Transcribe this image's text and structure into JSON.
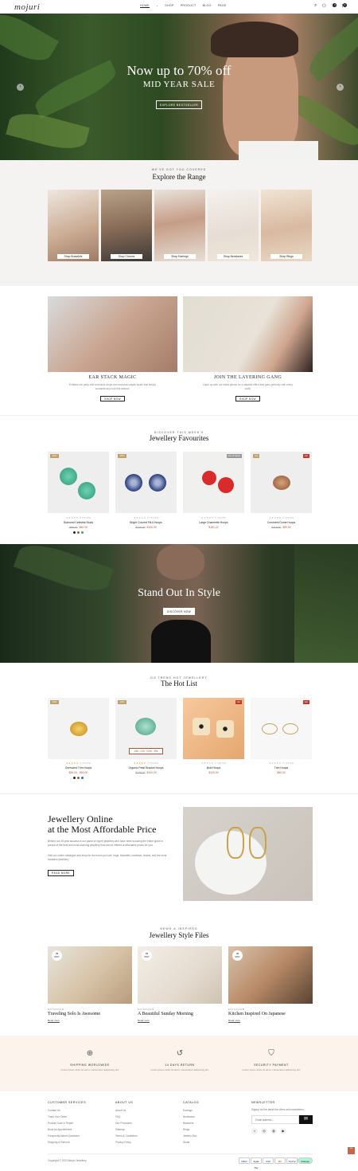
{
  "header": {
    "logo": "mojuri",
    "nav": [
      "HOME",
      "SHOP",
      "PRODUCT",
      "BLOG",
      "PAGE"
    ],
    "cart_count": "0",
    "wish_count": "0"
  },
  "hero": {
    "title": "Now up to 70% off",
    "subtitle": "MID YEAR SALE",
    "button": "EXPLORE BESTSELLER"
  },
  "range": {
    "kicker": "WE'VE GOT YOU COVERED",
    "title": "Explore the Range",
    "items": [
      "Shop Bracelets",
      "Shop Charms",
      "Shop Earrings",
      "Shop Necklaces",
      "Shop Rings"
    ]
  },
  "promos": [
    {
      "title": "EAR STACK MAGIC",
      "desc": "Endless ear party with exclusive drops and reworked staple styles that simply complete any look this season.",
      "button": "SHOP NOW"
    },
    {
      "title": "JOIN THE LAYERING GANG",
      "desc": "Layer up with our latest pieces for a stacked effect that pairs perfectly with every outfit.",
      "button": "SHOP NOW"
    }
  ],
  "favourites": {
    "kicker": "DISCOVER THIS WEEK'S",
    "title": "Jewellery Favourites",
    "products": [
      {
        "tag": "-20%",
        "name": "Diamond Celestial Studs",
        "old": "$96.00",
        "price": "$60.00",
        "reviews": "0 review"
      },
      {
        "tag": "-20%",
        "name": "Bright Colored Fill-it Hoops",
        "old": "$120.00",
        "price": "$100.00",
        "reviews": "0 review"
      },
      {
        "tag": "Out of Stock",
        "name": "Large Charmette Hoops",
        "old": "",
        "price": "$151.22",
        "reviews": "0 review"
      },
      {
        "tag": "Hot",
        "name": "Comment Dome Hoops",
        "old": "$110.00",
        "price": "$90.00",
        "reviews": "0 review"
      }
    ]
  },
  "stand": {
    "title": "Stand Out In Style",
    "button": "DISCOVER NOW"
  },
  "hotlist": {
    "kicker": "DO TREND HOT JEWELLERY",
    "title": "The Hot List",
    "countdown": [
      "155 : 21h : 02m : 39s"
    ],
    "products": [
      {
        "tag": "-20%",
        "name": "Oversized Trim Hoops",
        "old": "",
        "price": "$50.00 - $90.00",
        "reviews": "4 review"
      },
      {
        "tag": "-20%",
        "name": "Organic Pearl Bracket Hoops",
        "old": "$120.00",
        "price": "$100.00",
        "reviews": "4 review"
      },
      {
        "tag": "Hot",
        "name": "Bold Hoops",
        "old": "",
        "price": "$120.00",
        "reviews": "0 review"
      },
      {
        "tag": "Hot",
        "name": "Trim Hoops",
        "old": "",
        "price": "$60.00",
        "reviews": "0 review"
      }
    ]
  },
  "affordable": {
    "title_line1": "Jewellery Online",
    "title_line2": "at the Most Affordable Price",
    "p1": "Behind our 25 year success is our panel of expert jewellers who have been scouring the entire globe in pursuit of the best and most stunning jewellery that can be offered at affordable prices for you.",
    "p2": "Visit our online catalogue and shop for the trend you love: rings, bracelets, necklace, chains, and the most transitive jewellery.",
    "button": "READ MORE"
  },
  "blog": {
    "kicker": "NEWS & INSPIRED",
    "title": "Jewellery Style Files",
    "posts": [
      {
        "day": "09",
        "month": "MAY",
        "cat": "BATHROOM",
        "title": "Traveling Solo Is Awesome",
        "more": "Read more"
      },
      {
        "day": "09",
        "month": "MAY",
        "cat": "BATHROOM",
        "title": "A Beautiful Sunday Morning",
        "more": "Read more"
      },
      {
        "day": "09",
        "month": "MAY",
        "cat": "BATHROOM",
        "title": "Kitchen Inspired On Japanese",
        "more": "Read more"
      }
    ]
  },
  "features": [
    {
      "title": "SHIPPING WORLDWIDE",
      "desc": "Lorem ipsum dolor sit amet, consectetur adipiscing elit."
    },
    {
      "title": "14 DAYS RETURN",
      "desc": "Lorem ipsum dolor sit amet, consectetur adipiscing elit."
    },
    {
      "title": "SECURITY PAYMENT",
      "desc": "Lorem ipsum dolor sit amet, consectetur adipiscing elit."
    }
  ],
  "footer": {
    "cols": [
      {
        "title": "CUSTOMER SERVICES",
        "links": [
          "Contact Us",
          "Track Your Order",
          "Product Care & Repair",
          "Book an Appointment",
          "Frequently Asked Questions",
          "Shipping & Returns"
        ]
      },
      {
        "title": "ABOUT US",
        "links": [
          "About Us",
          "FAQ",
          "Our Producers",
          "Sitemap",
          "Terms & Conditions",
          "Privacy Policy"
        ]
      },
      {
        "title": "CATALOG",
        "links": [
          "Earrings",
          "Necklaces",
          "Bracelets",
          "Rings",
          "Jewelry Box",
          "Studs"
        ]
      }
    ],
    "newsletter": {
      "title": "NEWSLETTER",
      "desc": "Signup for the latest the offers and newsletters.",
      "placeholder": "Email address..."
    },
    "copyright": "Copyright © 2023 Mojuri Jewellery",
    "payments": [
      "AMEX",
      "Apple Pay",
      "VISA",
      "MC",
      "PayPal",
      "clearpay"
    ]
  },
  "colors": {
    "accent": "#b3543a",
    "tag_green": "#c1a06a",
    "tag_red": "#c0392b",
    "cream": "#fbf3ec"
  }
}
